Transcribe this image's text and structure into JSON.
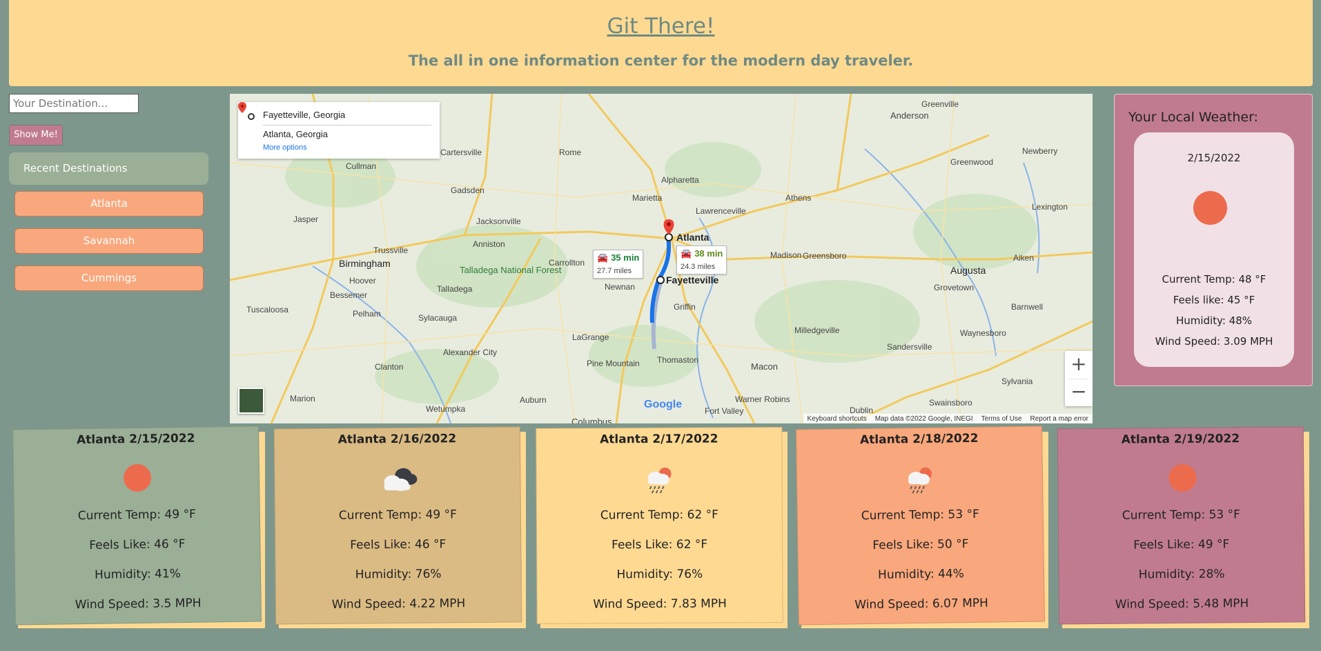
{
  "header": {
    "title": "Git There!",
    "subtitle": "The all in one information center for the modern day traveler."
  },
  "search": {
    "placeholder": "Your Destination...",
    "button_label": "Show Me!"
  },
  "recent": {
    "heading": "Recent Destinations",
    "items": [
      "Atlanta",
      "Savannah",
      "Cummings"
    ]
  },
  "map": {
    "directions": {
      "origin": "Fayetteville, Georgia",
      "destination": "Atlanta, Georgia",
      "more_options": "More options"
    },
    "routes": [
      {
        "time": "35 min",
        "distance": "27.7 miles",
        "color": "#188038"
      },
      {
        "time": "38 min",
        "distance": "24.3 miles",
        "color": "#5b8a1a"
      }
    ],
    "labels": {
      "atlanta": "Atlanta",
      "fayetteville": "Fayetteville",
      "park": "Talladega National Forest",
      "cities": [
        "Rome",
        "Alpharetta",
        "Marietta",
        "Lawrenceville",
        "Athens",
        "Gadsden",
        "Jacksonville",
        "Anniston",
        "Birmingham",
        "Hoover",
        "Bessemer",
        "Tuscaloosa",
        "Pelham",
        "Talladega",
        "Sylacauga",
        "Alexander City",
        "Clanton",
        "Wetumpka",
        "Carrollton",
        "Newnan",
        "Griffin",
        "LaGrange",
        "Pine Mountain",
        "Thomaston",
        "Macon",
        "Warner Robins",
        "Fort Valley",
        "Milledgeville",
        "Madison",
        "Greensboro",
        "Augusta",
        "Grovetown",
        "Aiken",
        "Anderson",
        "Greenwood",
        "Newberry",
        "Lexington",
        "Sandersville",
        "Waynesboro",
        "Swainsboro",
        "Dublin",
        "Sylvania",
        "Barnwell",
        "Auburn",
        "Columbus",
        "Cullman",
        "Jasper",
        "Trussville",
        "Marion",
        "Cartersville",
        "Greenville"
      ]
    },
    "zoom_in": "+",
    "zoom_out": "−",
    "google": "Google",
    "footer": [
      "Keyboard shortcuts",
      "Map data ©2022 Google, INEGI",
      "Terms of Use",
      "Report a map error"
    ]
  },
  "local_weather": {
    "heading": "Your Local Weather:",
    "date": "2/15/2022",
    "icon": "sun-icon",
    "current_temp": "Current Temp: 48 °F",
    "feels_like": "Feels like: 45 °F",
    "humidity": "Humidity: 48%",
    "wind_speed": "Wind Speed: 3.09 MPH"
  },
  "forecast": [
    {
      "title": "Atlanta 2/15/2022",
      "icon": "sun-icon",
      "bg": "#9aaf96",
      "current_temp": "Current Temp: 49 °F",
      "feels_like": "Feels Like: 46 °F",
      "humidity": "Humidity: 41%",
      "wind_speed": "Wind Speed: 3.5 MPH"
    },
    {
      "title": "Atlanta 2/16/2022",
      "icon": "cloudy-icon",
      "bg": "#dbbb84",
      "current_temp": "Current Temp: 49 °F",
      "feels_like": "Feels Like: 46 °F",
      "humidity": "Humidity: 76%",
      "wind_speed": "Wind Speed: 4.22 MPH"
    },
    {
      "title": "Atlanta 2/17/2022",
      "icon": "rain-sun-icon",
      "bg": "#fed992",
      "current_temp": "Current Temp: 62 °F",
      "feels_like": "Feels Like: 62 °F",
      "humidity": "Humidity: 76%",
      "wind_speed": "Wind Speed: 7.83 MPH"
    },
    {
      "title": "Atlanta 2/18/2022",
      "icon": "rain-sun-icon",
      "bg": "#f9a77c",
      "current_temp": "Current Temp: 53 °F",
      "feels_like": "Feels Like: 50 °F",
      "humidity": "Humidity: 44%",
      "wind_speed": "Wind Speed: 6.07 MPH"
    },
    {
      "title": "Atlanta 2/19/2022",
      "icon": "sun-icon",
      "bg": "#c07c8e",
      "current_temp": "Current Temp: 53 °F",
      "feels_like": "Feels Like: 49 °F",
      "humidity": "Humidity: 28%",
      "wind_speed": "Wind Speed: 5.48 MPH"
    }
  ],
  "colors": {
    "background": "#7d978c",
    "header": "#fed992",
    "accent_pink": "#c07c8e",
    "accent_orange": "#f9a77c",
    "accent_green": "#9aaf96",
    "sun": "#ec6b4d"
  }
}
